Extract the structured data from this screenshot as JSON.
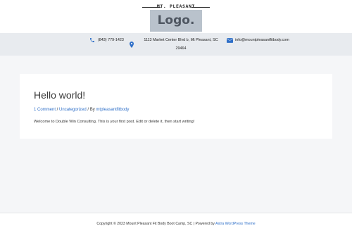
{
  "header": {
    "logo": {
      "tagline": "MT. PLEASANT",
      "text": "Logo."
    },
    "contact": {
      "phone": "(843) 779-1423",
      "address_line1": "1113 Market Center Blvd b, Mt Pleasant, SC",
      "address_line2": "29464",
      "email": "info@mountpleasantfitbody.com",
      "icons": {
        "phone": "phone-icon",
        "address": "map-pin-icon",
        "email": "envelope-icon"
      },
      "icon_color": "#2e6fc8"
    }
  },
  "post": {
    "title": "Hello world!",
    "meta": {
      "comments": "1 Comment",
      "separator1": " / ",
      "category": "Uncategorized",
      "separator2": " / By ",
      "author": "mtpleasantfitbody"
    },
    "body": "Welcome to Double Win Consulting. This is your first post. Edit or delete it, then start writing!"
  },
  "footer": {
    "copyright": "Copyright © 2023 Mount Pleasant Fit Body Boot Camp, SC | Powered by ",
    "theme_link": "Astra WordPress Theme"
  },
  "colors": {
    "accent": "#2e6fc8",
    "page_bg": "#f5f6f8",
    "header_bar_bg": "#e8ebef",
    "logo_bg": "#b9c2cc"
  }
}
